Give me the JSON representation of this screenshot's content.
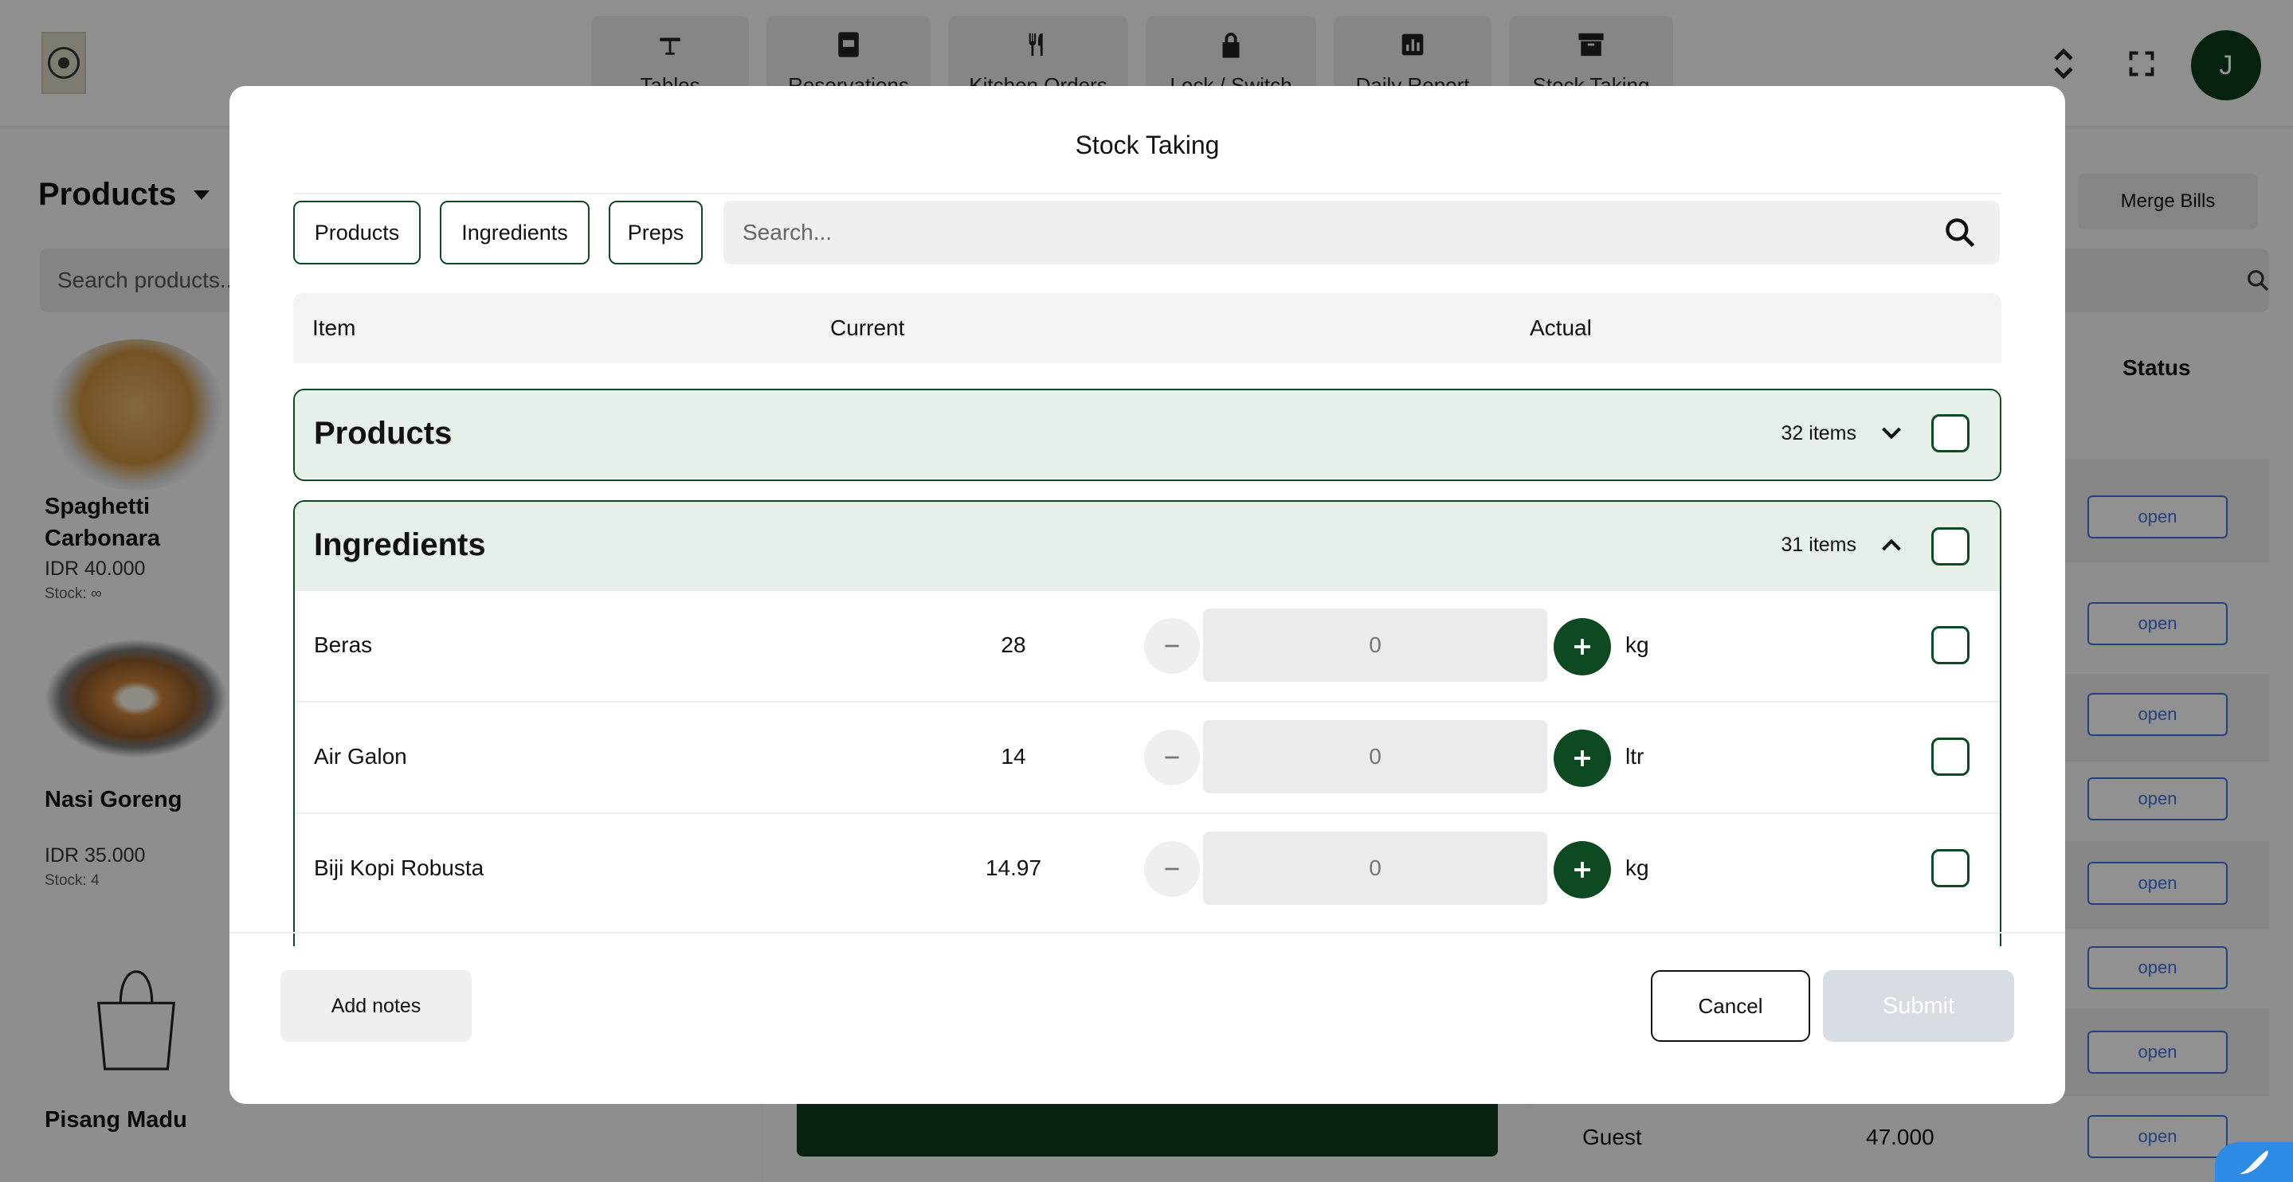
{
  "app": {
    "nav": [
      {
        "label": "Tables",
        "icon": "table-icon"
      },
      {
        "label": "Reservations",
        "icon": "calendar-icon"
      },
      {
        "label": "Kitchen Orders",
        "icon": "utensils-icon"
      },
      {
        "label": "Lock / Switch",
        "icon": "lock-icon"
      },
      {
        "label": "Daily Report",
        "icon": "chart-icon"
      },
      {
        "label": "Stock Taking",
        "icon": "archive-icon"
      }
    ],
    "avatar_initial": "J"
  },
  "left": {
    "title": "Products",
    "search_placeholder": "Search products...",
    "products": [
      {
        "name": "Spaghetti Carbonara",
        "price": "IDR 40.000",
        "stock": "Stock: ∞"
      },
      {
        "name": "Nasi Goreng",
        "price": "IDR 35.000",
        "stock": "Stock: 4"
      },
      {
        "name": "Pisang Madu"
      }
    ]
  },
  "right": {
    "merge_label": "Merge Bills",
    "status_header": "Status",
    "open_label": "open",
    "guest_label": "Guest",
    "guest_amount": "47.000"
  },
  "modal": {
    "title": "Stock Taking",
    "tabs": [
      "Products",
      "Ingredients",
      "Preps"
    ],
    "search_placeholder": "Search...",
    "columns": {
      "item": "Item",
      "current": "Current",
      "actual": "Actual"
    },
    "groups": [
      {
        "name": "Products",
        "count": "32 items",
        "expanded": false
      },
      {
        "name": "Ingredients",
        "count": "31 items",
        "expanded": true,
        "rows": [
          {
            "name": "Beras",
            "current": "28",
            "actual": "0",
            "unit": "kg"
          },
          {
            "name": "Air Galon",
            "current": "14",
            "actual": "0",
            "unit": "ltr"
          },
          {
            "name": "Biji Kopi Robusta",
            "current": "14.97",
            "actual": "0",
            "unit": "kg"
          }
        ]
      }
    ],
    "add_notes_label": "Add notes",
    "cancel_label": "Cancel",
    "submit_label": "Submit"
  },
  "colors": {
    "brand": "#0d4a22",
    "group_bg": "#e6efe8",
    "link": "#3e6fd8",
    "disabled": "#d8dce3"
  }
}
